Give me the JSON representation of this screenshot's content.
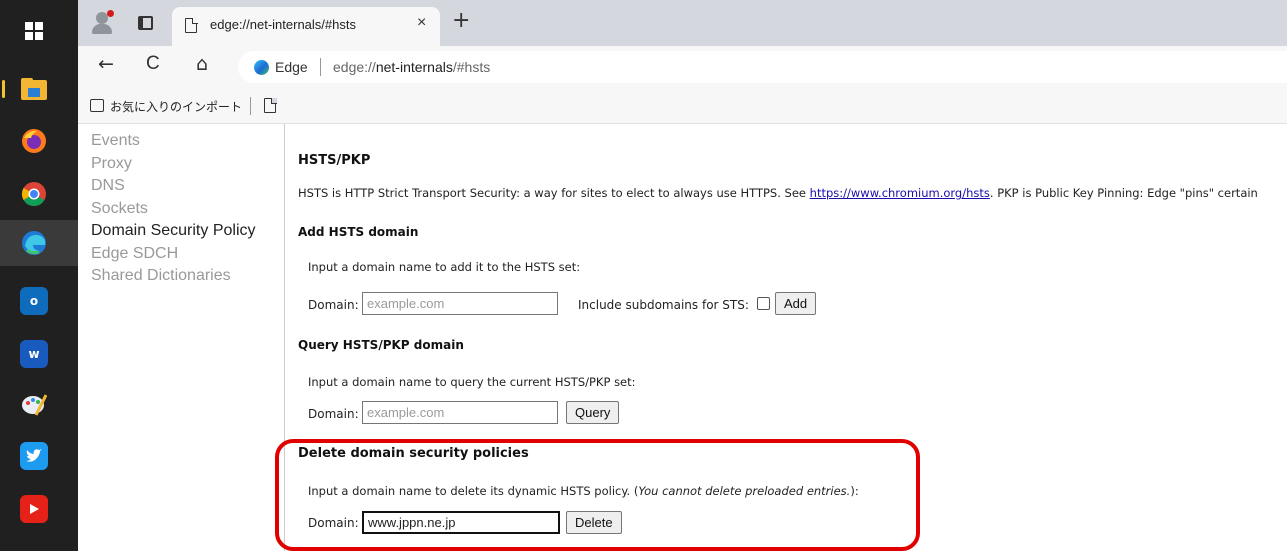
{
  "taskbar": {
    "icons": [
      "windows-start-icon",
      "file-explorer-icon",
      "firefox-icon",
      "chrome-icon",
      "edge-icon",
      "outlook-icon",
      "word-icon",
      "paint-icon",
      "twitter-icon",
      "youtube-icon"
    ],
    "glyphs": {
      "outlook": "o",
      "word": "w"
    }
  },
  "tabstrip": {
    "tab_title": "edge://net-internals/#hsts",
    "close_glyph": "×",
    "new_tab_glyph": "+"
  },
  "toolbar": {
    "back_glyph": "←",
    "refresh_glyph": "C",
    "home_glyph": "⌂",
    "brand": "Edge",
    "url_prefix": "edge://",
    "url_host": "net-internals",
    "url_suffix": "/#hsts"
  },
  "favorites": {
    "import_label": "お気に入りのインポート"
  },
  "sidebar": {
    "items": [
      {
        "label": "Events"
      },
      {
        "label": "Proxy"
      },
      {
        "label": "DNS"
      },
      {
        "label": "Sockets"
      },
      {
        "label": "Domain Security Policy",
        "selected": true
      },
      {
        "label": "Edge SDCH"
      },
      {
        "label": "Shared Dictionaries"
      }
    ]
  },
  "main": {
    "title": "HSTS/PKP",
    "intro_before": "HSTS is HTTP Strict Transport Security: a way for sites to elect to always use HTTPS. See ",
    "intro_link": "https://www.chromium.org/hsts",
    "intro_after": ". PKP is Public Key Pinning: Edge \"pins\" certain",
    "add": {
      "heading": "Add HSTS domain",
      "description": "Input a domain name to add it to the HSTS set:",
      "domain_label": "Domain:",
      "placeholder": "example.com",
      "include_subdomains_label": "Include subdomains for STS:",
      "button": "Add"
    },
    "query": {
      "heading": "Query HSTS/PKP domain",
      "description": "Input a domain name to query the current HSTS/PKP set:",
      "domain_label": "Domain:",
      "placeholder": "example.com",
      "button": "Query"
    },
    "delete": {
      "heading": "Delete domain security policies",
      "description_before": "Input a domain name to delete its dynamic HSTS policy. (",
      "description_italic": "You cannot delete preloaded entries.",
      "description_after": "):",
      "domain_label": "Domain:",
      "value": "www.jppn.ne.jp",
      "button": "Delete"
    }
  },
  "colors": {
    "highlight": "#e00000",
    "link": "#1a0dab",
    "taskbar": "#202020"
  }
}
